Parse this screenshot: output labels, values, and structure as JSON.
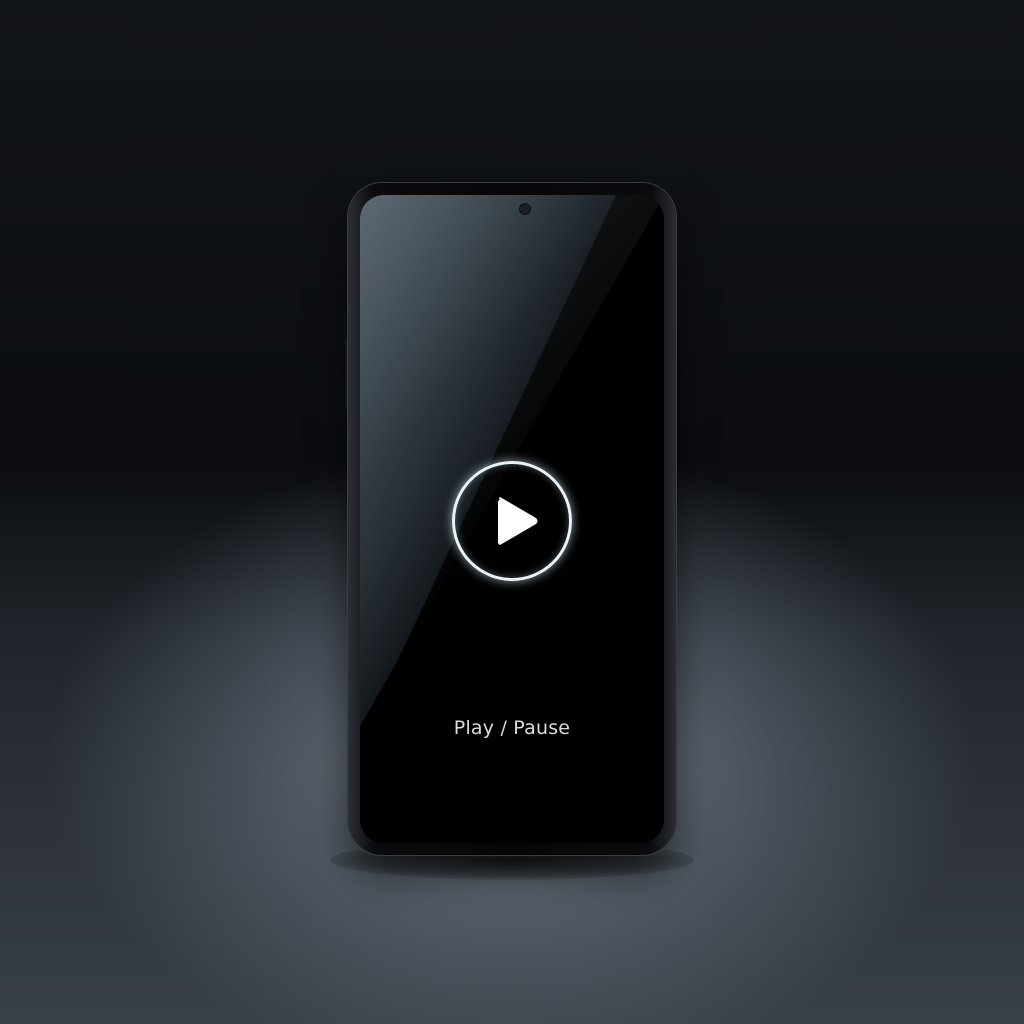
{
  "screen": {
    "control_label": "Play / Pause",
    "control_icon": "play-icon"
  },
  "colors": {
    "ring": "#e9f2f6",
    "label_text": "#d9dde0",
    "screen_background": "#000000"
  }
}
